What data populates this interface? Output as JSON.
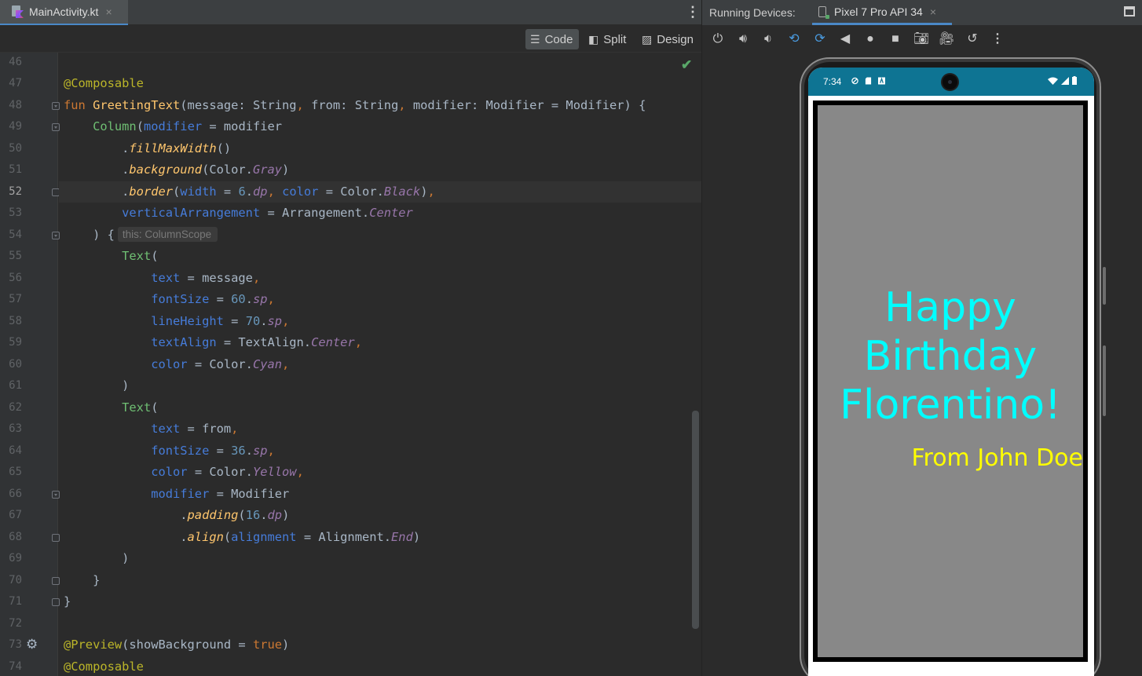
{
  "editor": {
    "file_tab": "MainActivity.kt",
    "tab_close": "×",
    "modes": {
      "code": "Code",
      "split": "Split",
      "design": "Design"
    },
    "inlay_hint": "this: ColumnScope",
    "current_line": 52,
    "line_numbers": [
      "46",
      "47",
      "48",
      "49",
      "50",
      "51",
      "52",
      "53",
      "54",
      "55",
      "56",
      "57",
      "58",
      "59",
      "60",
      "61",
      "62",
      "63",
      "64",
      "65",
      "66",
      "67",
      "68",
      "69",
      "70",
      "71",
      "72",
      "73",
      "74"
    ],
    "code_lines": [
      [],
      [
        [
          "an",
          "@Composable"
        ]
      ],
      [
        [
          "kw",
          "fun "
        ],
        [
          "fn",
          "GreetingText"
        ],
        [
          "pl",
          "(message: String"
        ],
        [
          "kw",
          ", "
        ],
        [
          "pl",
          "from: String"
        ],
        [
          "kw",
          ", "
        ],
        [
          "pl",
          "modifier: Modifier = Modifier) {"
        ]
      ],
      [
        [
          "pl",
          "    "
        ],
        [
          "gr",
          "Column"
        ],
        [
          "pl",
          "("
        ],
        [
          "pb",
          "modifier"
        ],
        [
          "pl",
          " = modifier"
        ]
      ],
      [
        [
          "pl",
          "        ."
        ],
        [
          "fi",
          "fillMaxWidth"
        ],
        [
          "pl",
          "()"
        ]
      ],
      [
        [
          "pl",
          "        ."
        ],
        [
          "fi",
          "background"
        ],
        [
          "pl",
          "(Color."
        ],
        [
          "pi",
          "Gray"
        ],
        [
          "pl",
          ")"
        ]
      ],
      [
        [
          "pl",
          "        ."
        ],
        [
          "fi",
          "border"
        ],
        [
          "pl",
          "("
        ],
        [
          "pb",
          "width"
        ],
        [
          "pl",
          " = "
        ],
        [
          "nm",
          "6"
        ],
        [
          "pl",
          "."
        ],
        [
          "pi",
          "dp"
        ],
        [
          "kw",
          ", "
        ],
        [
          "pb",
          "color"
        ],
        [
          "pl",
          " = Color."
        ],
        [
          "pi",
          "Black"
        ],
        [
          "pl",
          ")"
        ],
        [
          "kw",
          ","
        ]
      ],
      [
        [
          "pl",
          "        "
        ],
        [
          "pb",
          "verticalArrangement"
        ],
        [
          "pl",
          " = Arrangement."
        ],
        [
          "pi",
          "Center"
        ]
      ],
      [
        [
          "pl",
          "    ) {"
        ],
        [
          "hint",
          "this: ColumnScope"
        ]
      ],
      [
        [
          "pl",
          "        "
        ],
        [
          "gr",
          "Text"
        ],
        [
          "pl",
          "("
        ]
      ],
      [
        [
          "pl",
          "            "
        ],
        [
          "pb",
          "text"
        ],
        [
          "pl",
          " = message"
        ],
        [
          "kw",
          ","
        ]
      ],
      [
        [
          "pl",
          "            "
        ],
        [
          "pb",
          "fontSize"
        ],
        [
          "pl",
          " = "
        ],
        [
          "nm",
          "60"
        ],
        [
          "pl",
          "."
        ],
        [
          "pi",
          "sp"
        ],
        [
          "kw",
          ","
        ]
      ],
      [
        [
          "pl",
          "            "
        ],
        [
          "pb",
          "lineHeight"
        ],
        [
          "pl",
          " = "
        ],
        [
          "nm",
          "70"
        ],
        [
          "pl",
          "."
        ],
        [
          "pi",
          "sp"
        ],
        [
          "kw",
          ","
        ]
      ],
      [
        [
          "pl",
          "            "
        ],
        [
          "pb",
          "textAlign"
        ],
        [
          "pl",
          " = TextAlign."
        ],
        [
          "pi",
          "Center"
        ],
        [
          "kw",
          ","
        ]
      ],
      [
        [
          "pl",
          "            "
        ],
        [
          "pb",
          "color"
        ],
        [
          "pl",
          " = Color."
        ],
        [
          "pi",
          "Cyan"
        ],
        [
          "kw",
          ","
        ]
      ],
      [
        [
          "pl",
          "        )"
        ]
      ],
      [
        [
          "pl",
          "        "
        ],
        [
          "gr",
          "Text"
        ],
        [
          "pl",
          "("
        ]
      ],
      [
        [
          "pl",
          "            "
        ],
        [
          "pb",
          "text"
        ],
        [
          "pl",
          " = from"
        ],
        [
          "kw",
          ","
        ]
      ],
      [
        [
          "pl",
          "            "
        ],
        [
          "pb",
          "fontSize"
        ],
        [
          "pl",
          " = "
        ],
        [
          "nm",
          "36"
        ],
        [
          "pl",
          "."
        ],
        [
          "pi",
          "sp"
        ],
        [
          "kw",
          ","
        ]
      ],
      [
        [
          "pl",
          "            "
        ],
        [
          "pb",
          "color"
        ],
        [
          "pl",
          " = Color."
        ],
        [
          "pi",
          "Yellow"
        ],
        [
          "kw",
          ","
        ]
      ],
      [
        [
          "pl",
          "            "
        ],
        [
          "pb",
          "modifier"
        ],
        [
          "pl",
          " = Modifier"
        ]
      ],
      [
        [
          "pl",
          "                ."
        ],
        [
          "fi",
          "padding"
        ],
        [
          "pl",
          "("
        ],
        [
          "nm",
          "16"
        ],
        [
          "pl",
          "."
        ],
        [
          "pi",
          "dp"
        ],
        [
          "pl",
          ")"
        ]
      ],
      [
        [
          "pl",
          "                ."
        ],
        [
          "fi",
          "align"
        ],
        [
          "pl",
          "("
        ],
        [
          "pb",
          "alignment"
        ],
        [
          "pl",
          " = Alignment."
        ],
        [
          "pi",
          "End"
        ],
        [
          "pl",
          ")"
        ]
      ],
      [
        [
          "pl",
          "        )"
        ]
      ],
      [
        [
          "pl",
          "    }"
        ]
      ],
      [
        [
          "pl",
          "}"
        ]
      ],
      [],
      [
        [
          "an",
          "@Preview"
        ],
        [
          "pl",
          "(showBackground = "
        ],
        [
          "kw",
          "true"
        ],
        [
          "pl",
          ")"
        ]
      ],
      [
        [
          "an",
          "@Composable"
        ]
      ]
    ]
  },
  "devices": {
    "label": "Running Devices:",
    "device_tab": "Pixel 7 Pro API 34",
    "tab_close": "×",
    "toolbar_icons": [
      "power-icon",
      "volume-up-icon",
      "volume-down-icon",
      "rotate-left-icon",
      "rotate-right-icon",
      "back-icon",
      "home-icon",
      "overview-icon",
      "screenshot-icon",
      "record-icon",
      "reset-icon",
      "more-icon"
    ],
    "status_time": "7:34",
    "greeting": "Happy Birthday Florentino!",
    "from": "From John Doe"
  },
  "colors": {
    "statusbar": "#0e7493",
    "app_background": "#888888",
    "greeting_text": "#00ffff",
    "from_text": "#ffff00",
    "border": "#000000"
  }
}
